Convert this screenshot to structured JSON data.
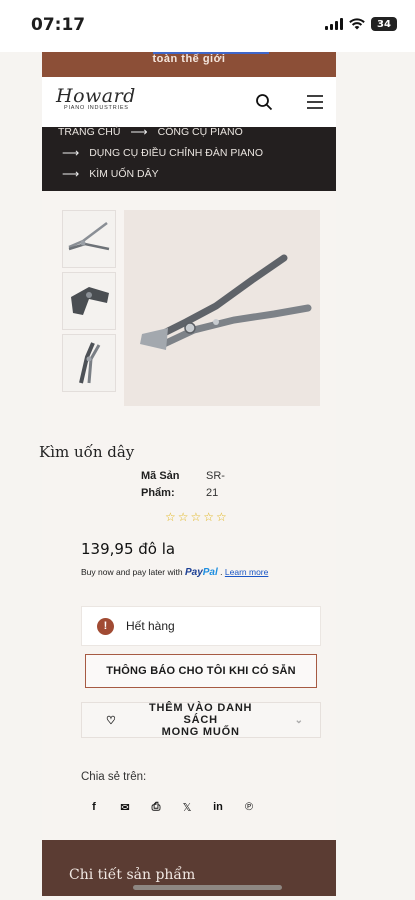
{
  "status": {
    "time": "07:17",
    "battery": "34"
  },
  "announcement": "toàn thế giới",
  "header": {
    "logo_main": "Howard",
    "logo_sub": "PIANO INDUSTRIES"
  },
  "breadcrumb": [
    "TRANG CHỦ",
    "CÔNG CỤ PIANO",
    "DỤNG CỤ ĐIỀU CHỈNH ĐÀN PIANO",
    "KÌM UỐN DÂY"
  ],
  "icons": {
    "search": "search-icon",
    "menu": "hamburger-menu-icon"
  },
  "product": {
    "title": "Kìm uốn dây",
    "sku_label_line1": "Mã Sản",
    "sku_label_line2": "Phẩm:",
    "sku_value_line1": "SR-",
    "sku_value_line2": "21",
    "rating_stars": "☆☆☆☆☆",
    "rating": 0,
    "price": "139,95 đô la"
  },
  "paypal": {
    "prefix": "Buy now and pay later with",
    "brand_a": "Pay",
    "brand_b": "Pal",
    "sep": " .",
    "link": "Learn more"
  },
  "stock": {
    "icon": "!",
    "text": "Hết hàng"
  },
  "buttons": {
    "notify": "THÔNG BÁO CHO TÔI KHI CÓ SẴN",
    "wishlist_line1": "THÊM VÀO DANH SÁCH",
    "wishlist_line2": "MONG MUỐN"
  },
  "share": {
    "label": "Chia sẻ trên:",
    "icons": [
      "facebook-icon",
      "email-icon",
      "print-icon",
      "x-icon",
      "linkedin-icon",
      "pinterest-icon"
    ]
  },
  "details": {
    "heading": "Chi tiết sản phẩm"
  },
  "colors": {
    "brand_brown": "#8c4f37",
    "dark": "#231f1f",
    "details_bg": "#5b3c33",
    "alert": "#a14b33",
    "paypal_blue": "#1c3f94"
  }
}
